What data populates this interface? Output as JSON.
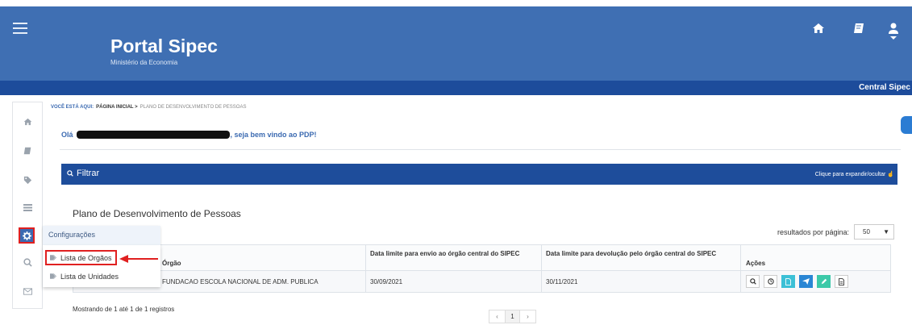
{
  "header": {
    "title": "Portal Sipec",
    "subtitle": "Ministério da Economia",
    "bar_right": "Central Sipec",
    "icons": [
      "menu-icon",
      "home-icon",
      "book-icon",
      "user-icon"
    ]
  },
  "breadcrumb": {
    "label": "VOCÊ ESTÁ AQUI:",
    "home": "PÁGINA INICIAL >",
    "current": "PLANO DE DESENVOLVIMENTO DE PESSOAS"
  },
  "welcome": {
    "prefix": "Olá",
    "suffix": ", seja bem vindo ao PDP!"
  },
  "filter": {
    "label": "Filtrar",
    "hint": "Clique para expandir/ocultar"
  },
  "sidebar": {
    "icons": [
      "home-icon",
      "book-icon",
      "tag-icon",
      "list-icon",
      "gear-icon",
      "search-icon",
      "envelope-icon"
    ]
  },
  "flyout": {
    "header": "Configurações",
    "items": [
      "Lista de Orgãos",
      "Lista de Unidades"
    ]
  },
  "section": {
    "title": "Plano de Desenvolvimento de Pessoas"
  },
  "pagination": {
    "per_page_label": "resultados por página:",
    "per_page_value": "50",
    "showing": "Mostrando de 1 até 1 de 1 registros",
    "prev": "‹",
    "page": "1",
    "next": "›"
  },
  "table": {
    "headers": [
      "Órgão",
      "Data limite para envio ao órgão central do SIPEC",
      "Data limite para devolução pelo órgão central do SIPEC",
      "Ações"
    ],
    "rows": [
      {
        "orgao": "FUNDACAO ESCOLA NACIONAL DE ADM. PUBLICA",
        "envio": "30/09/2021",
        "devolucao": "30/11/2021"
      }
    ],
    "actions": [
      "search-icon",
      "clock-icon",
      "document-icon",
      "send-icon",
      "edit-icon",
      "pdf-icon"
    ]
  },
  "colors": {
    "header": "#3f6fb3",
    "bar": "#1d4c9b",
    "highlight": "#e02020"
  }
}
